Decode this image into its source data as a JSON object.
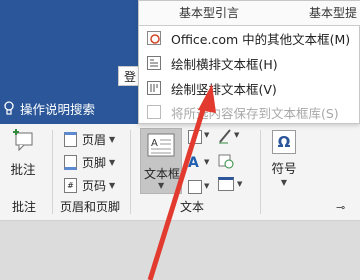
{
  "window": {
    "login_label": "登"
  },
  "tellme": {
    "label": "操作说明搜索"
  },
  "ribbon": {
    "comment": {
      "label": "批注",
      "group": "批注"
    },
    "header_footer": {
      "header": "页眉",
      "footer": "页脚",
      "page_number": "页码",
      "group": "页眉和页脚"
    },
    "text": {
      "textbox": "文本框",
      "group": "文本"
    },
    "symbol": {
      "label": "符号",
      "omega": "Ω"
    }
  },
  "menu": {
    "top_labels": [
      "基本型引言",
      "基本型提"
    ],
    "items": [
      {
        "label": "Office.com 中的其他文本框(M)",
        "disabled": false
      },
      {
        "label": "绘制横排文本框(H)",
        "disabled": false
      },
      {
        "label": "绘制竖排文本框(V)",
        "disabled": false
      },
      {
        "label": "将所选内容保存到文本框库(S)",
        "disabled": true
      }
    ]
  },
  "colors": {
    "title_bar": "#2b579a",
    "annotation_arrow": "#e23a2e"
  }
}
